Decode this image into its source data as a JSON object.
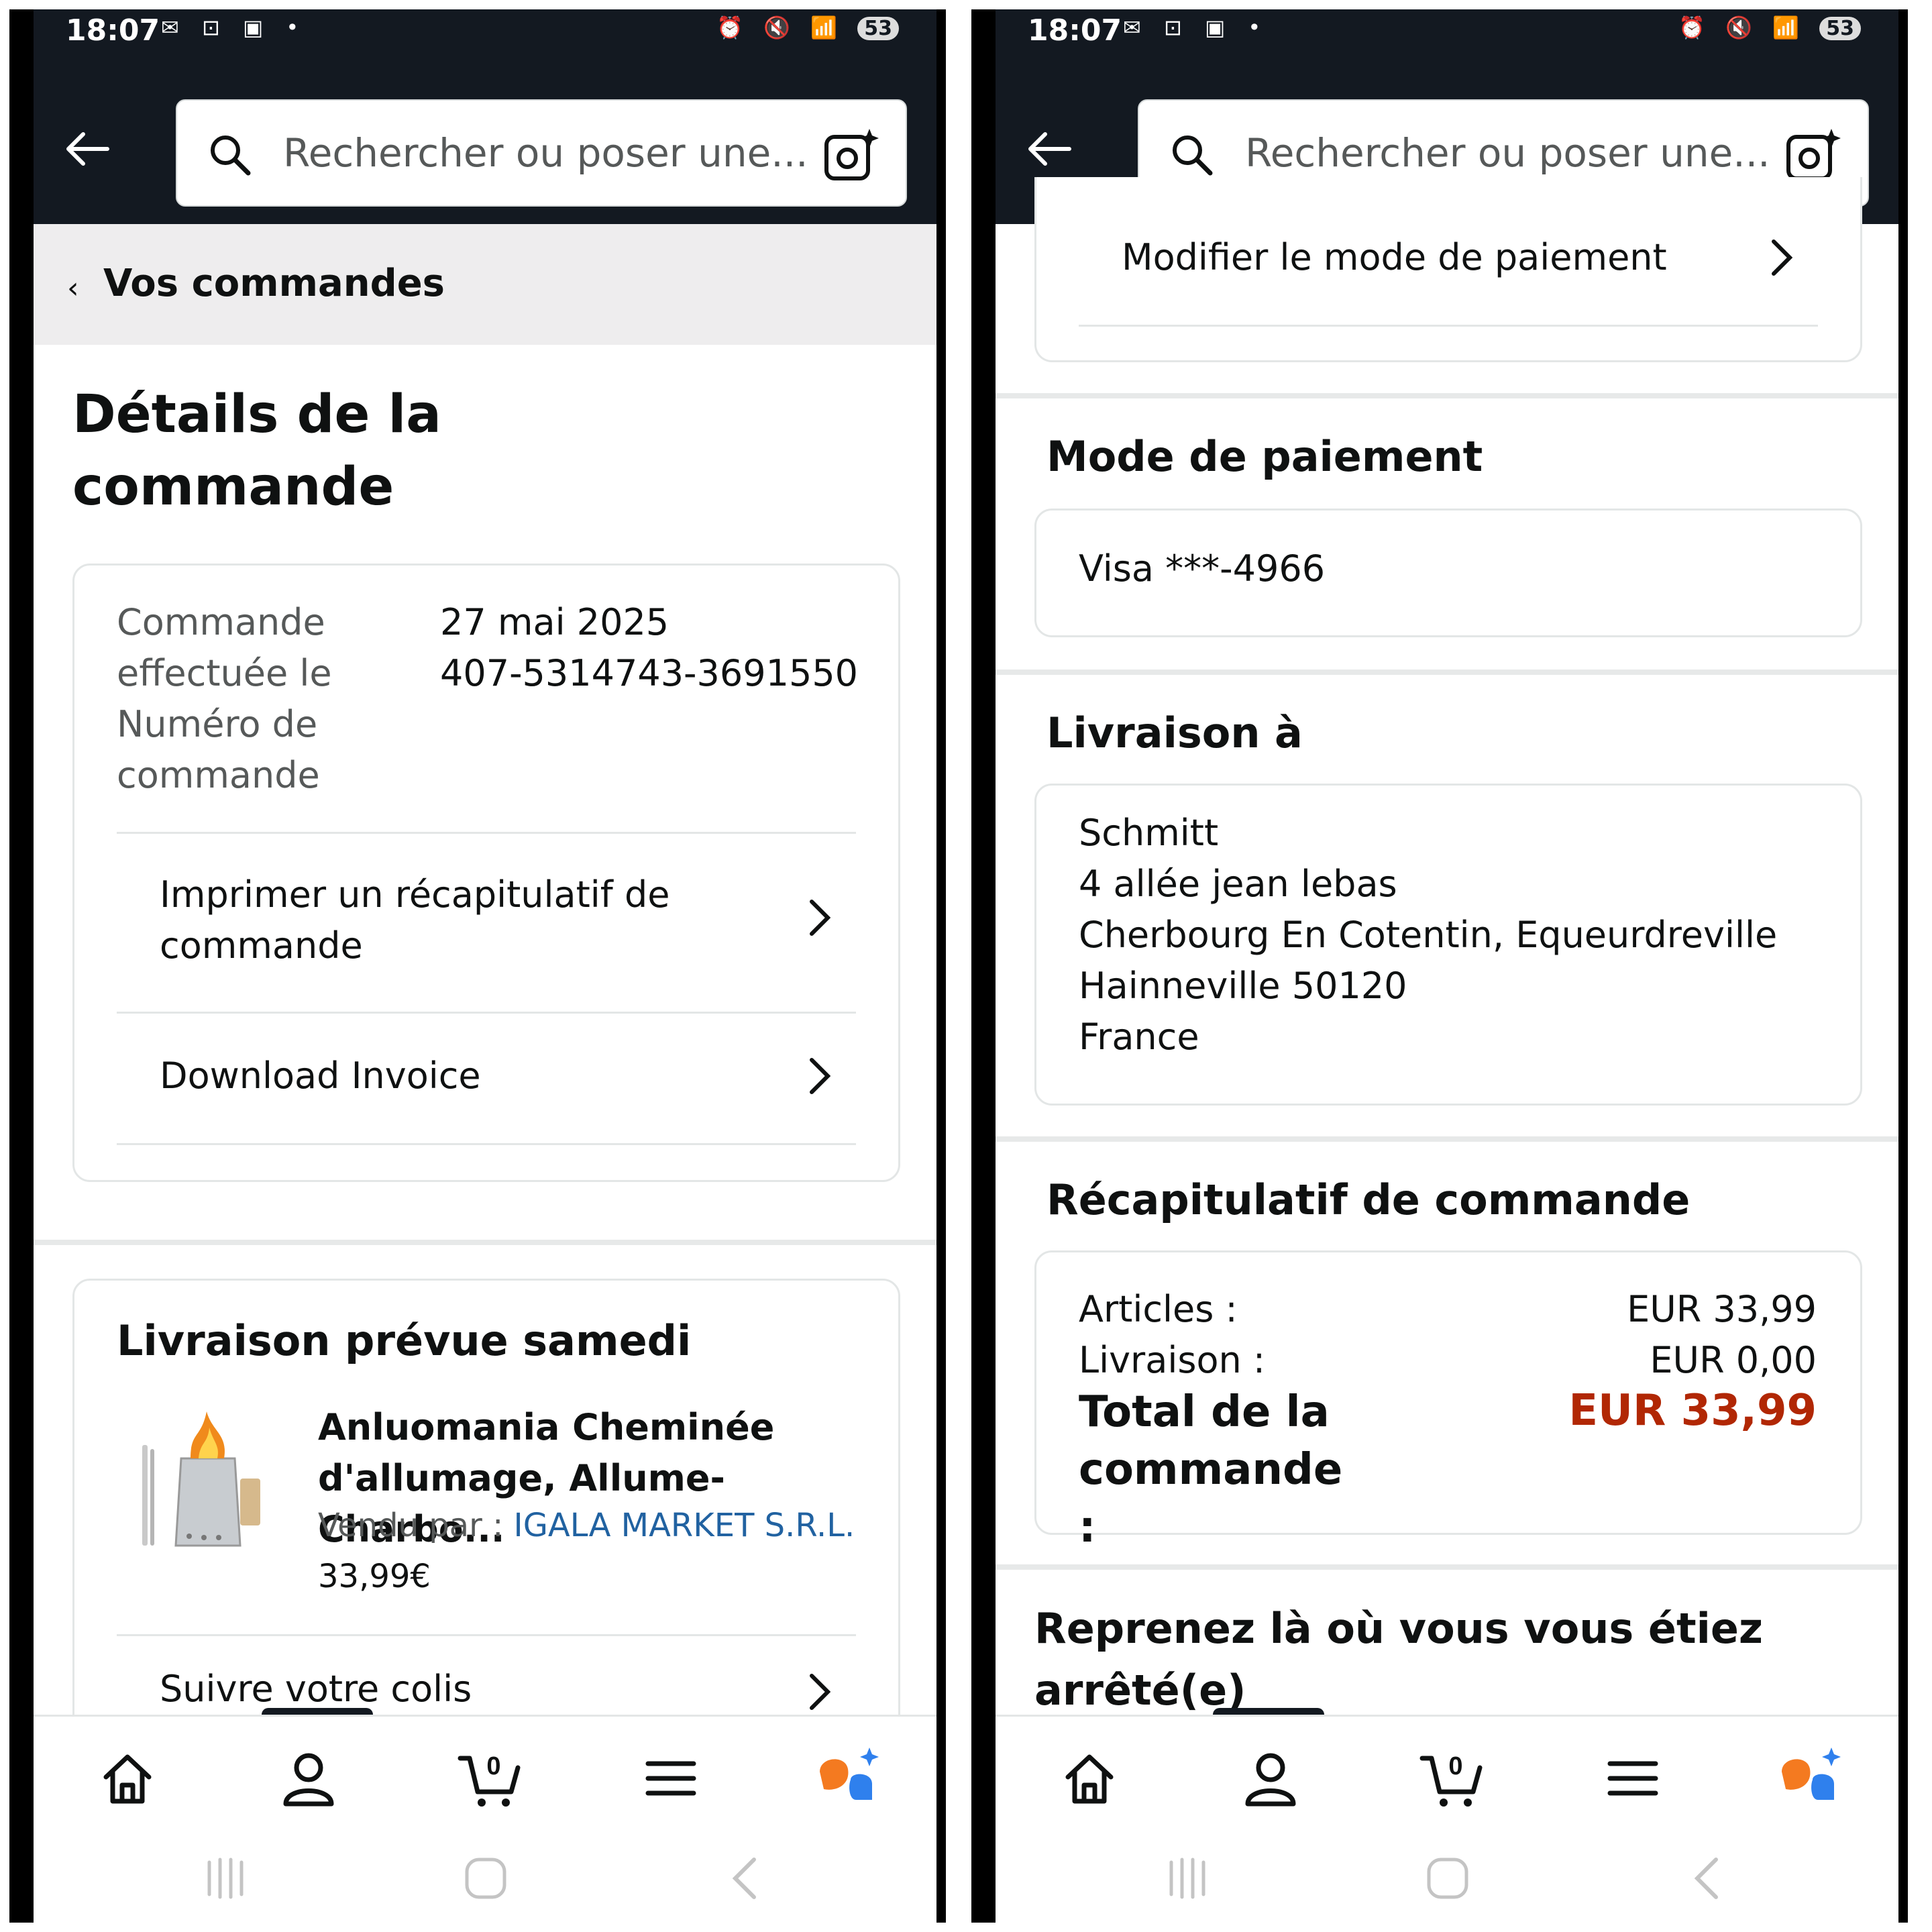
{
  "status_bar": {
    "time": "18:07",
    "battery": "53",
    "left_icons": "✉ ⊡ ▣ •",
    "right_icons": "⏰ 🔇 📶"
  },
  "header": {
    "search_placeholder": "Rechercher ou poser une..."
  },
  "left_screen": {
    "breadcrumb": "Vos commandes",
    "page_title": "Détails de la commande",
    "order_info": {
      "placed_label": "Commande effectuée le",
      "placed_value": "27 mai 2025",
      "number_label": "Numéro de commande",
      "number_value": "407-5314743-3691550"
    },
    "actions": {
      "print_summary": "Imprimer un récapitulatif de commande",
      "download_invoice": "Download Invoice"
    },
    "delivery": {
      "title": "Livraison prévue samedi",
      "product_name": "Anluomania Cheminée d'allumage, Allume-Charbo...",
      "sold_by_label": "Vendu par",
      "seller": "IGALA MARKET S.R.L.",
      "price": "33,99€",
      "track": "Suivre votre colis"
    }
  },
  "right_screen": {
    "change_payment": "Modifier le mode de paiement",
    "payment_title": "Mode de paiement",
    "payment_card": "Visa ***-4966",
    "shipping_title": "Livraison à",
    "address_lines": {
      "name": "Schmitt",
      "street": "4 allée jean lebas",
      "city": "Cherbourg En Cotentin, Equeurdreville",
      "postal": "Hainneville 50120",
      "country": "France"
    },
    "summary_title": "Récapitulatif de commande",
    "summary": {
      "items_label": "Articles :",
      "items_value": "EUR 33,99",
      "shipping_label": "Livraison :",
      "shipping_value": "EUR 0,00",
      "total_label": "Total de la commande :",
      "total_value": "EUR 33,99"
    },
    "resume_title": "Reprenez là où vous vous étiez arrêté(e)"
  },
  "bottom_nav": {
    "cart_count": "0",
    "icons": [
      "home-icon",
      "account-icon",
      "cart-icon",
      "menu-icon",
      "rufus-icon"
    ]
  },
  "colors": {
    "header_bg": "#131921",
    "link": "#2162a1",
    "price_red": "#b12704",
    "breadcrumb_bg": "#eeedee",
    "assistant_orange": "#f47a20",
    "assistant_blue": "#2f80ed"
  }
}
